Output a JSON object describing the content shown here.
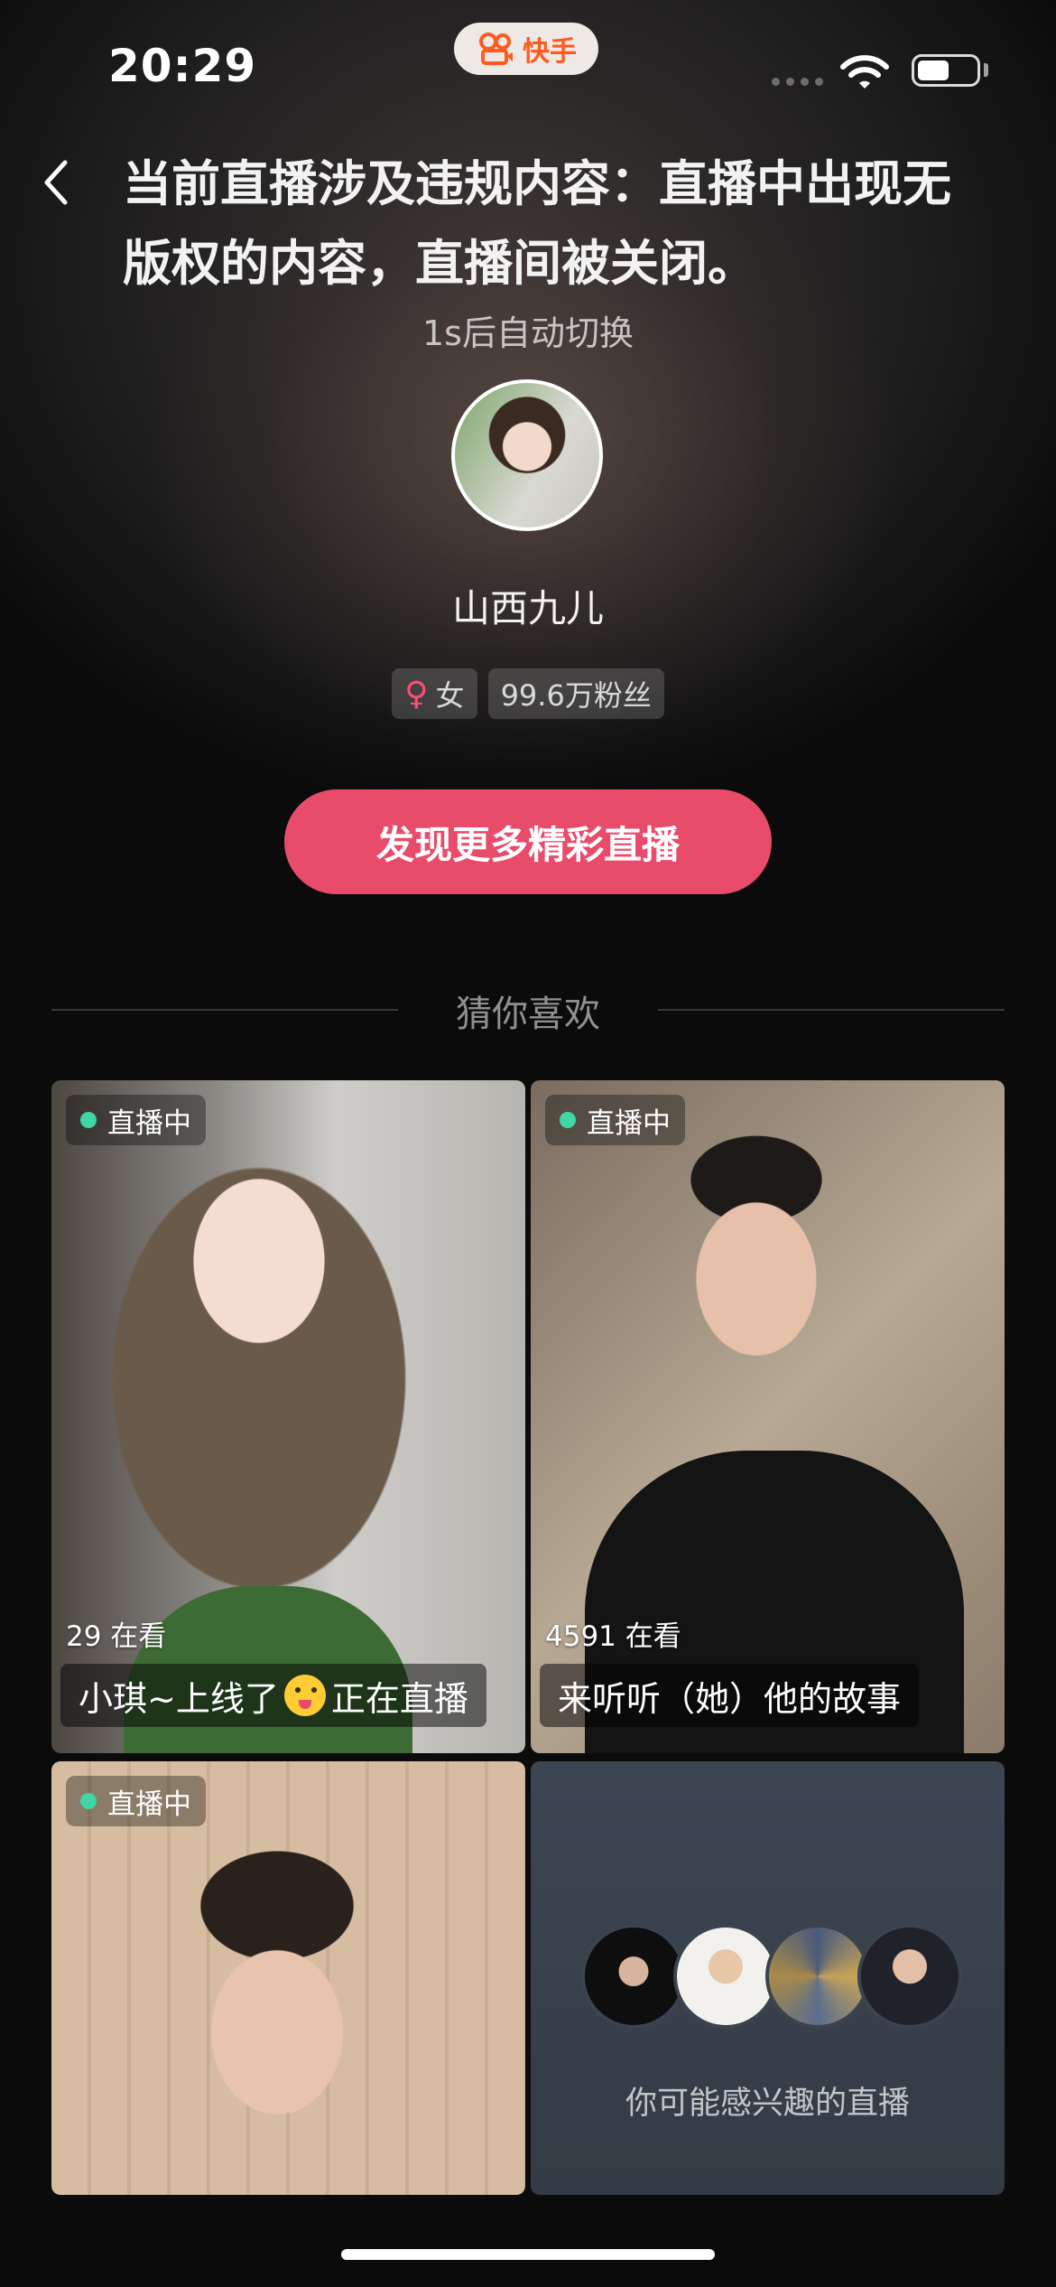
{
  "status_bar": {
    "time": "20:29",
    "app_name": "快手"
  },
  "header": {
    "back_icon": "chevron-left-icon",
    "message": "当前直播涉及违规内容：直播中出现无版权的内容，直播间被关闭。",
    "countdown": "1s后自动切换"
  },
  "streamer": {
    "name": "山西九儿",
    "gender_symbol": "♀",
    "gender": "女",
    "fans": "99.6万粉丝"
  },
  "cta_label": "发现更多精彩直播",
  "section_title": "猜你喜欢",
  "cards": [
    {
      "live_label": "直播中",
      "viewers": "29 在看",
      "title_before": "小琪~上线了",
      "title_after": "正在直播"
    },
    {
      "live_label": "直播中",
      "viewers": "4591 在看",
      "title": "来听听（她）他的故事"
    },
    {
      "live_label": "直播中"
    },
    {
      "caption": "你可能感兴趣的直播"
    }
  ],
  "colors": {
    "accent": "#e94c6b",
    "live_dot": "#3fd7a5",
    "brand": "#ff5a1f"
  }
}
